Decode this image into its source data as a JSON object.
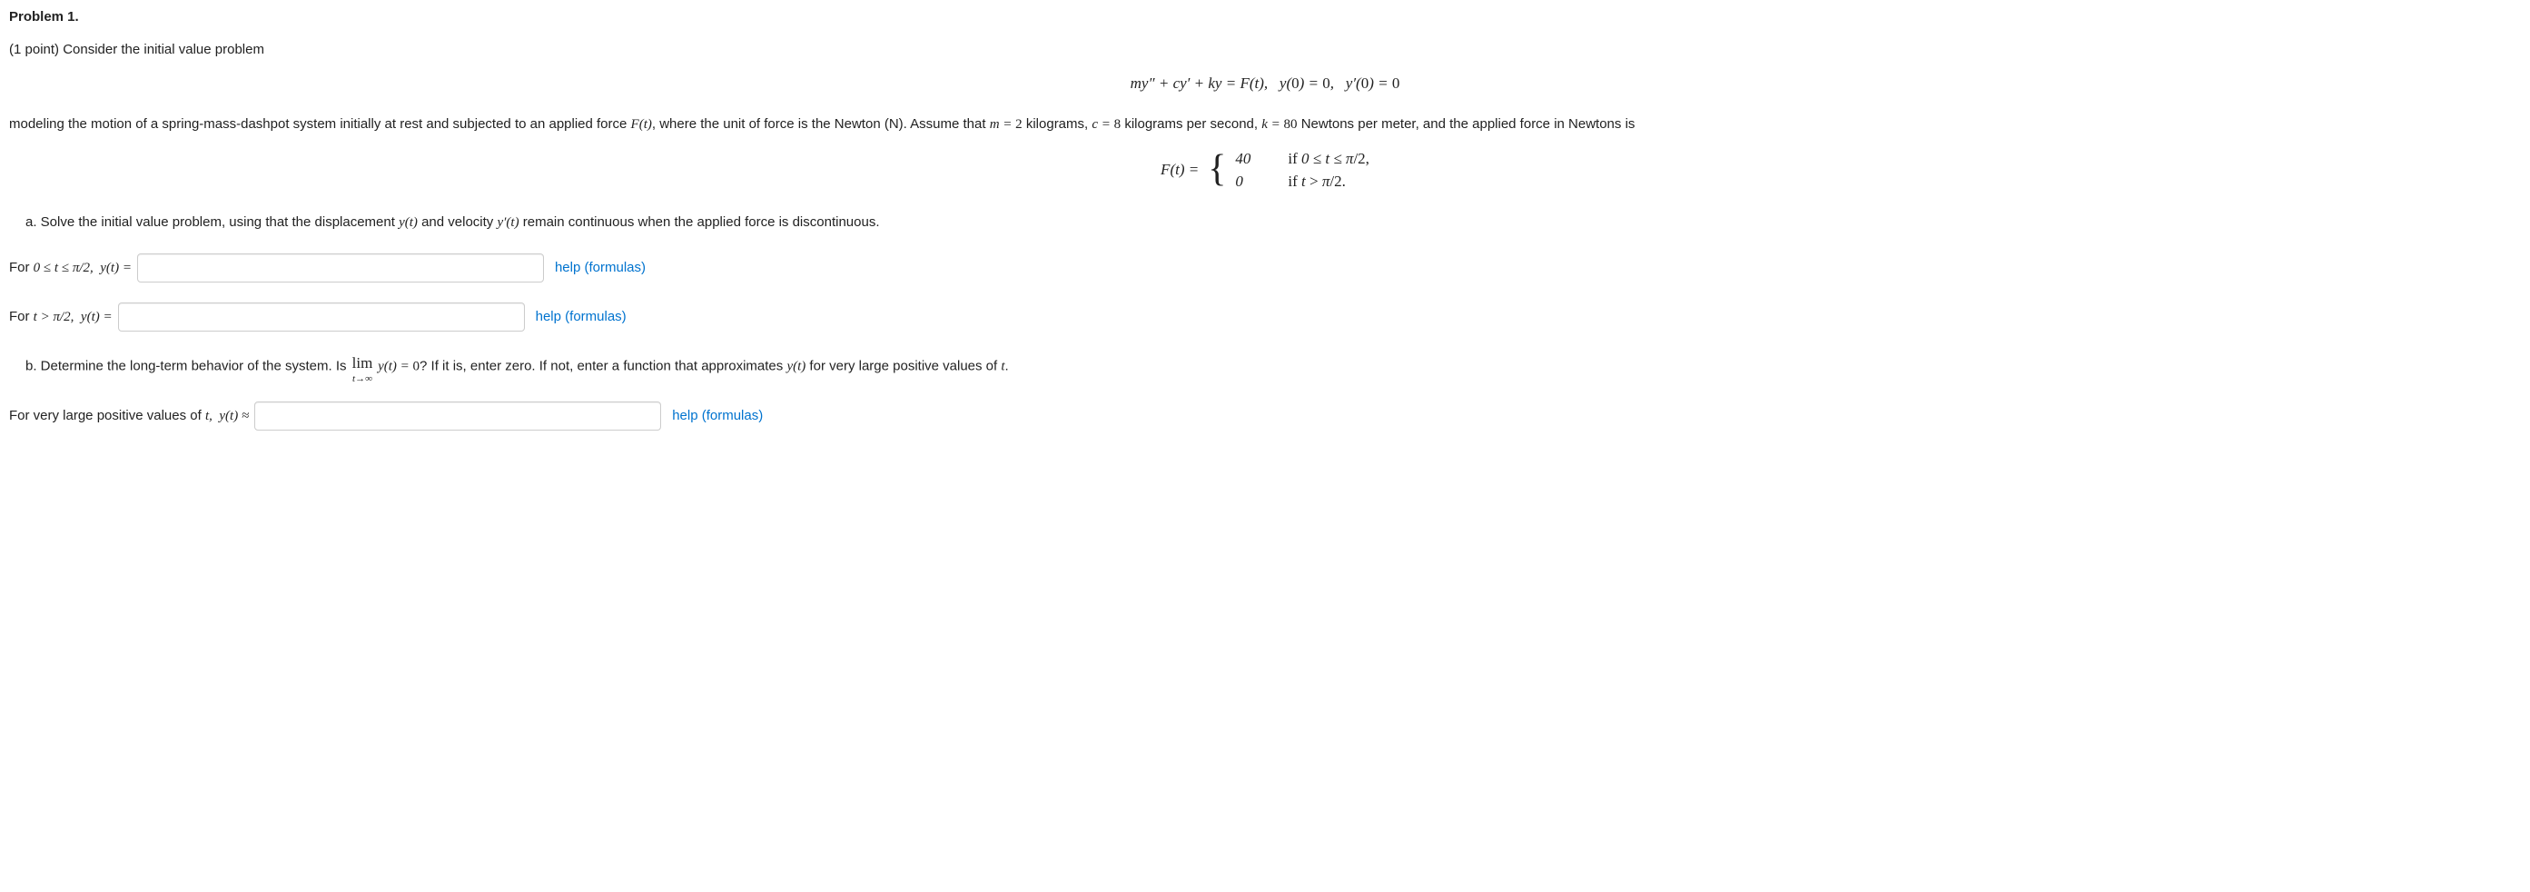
{
  "header": {
    "title": "Problem 1."
  },
  "intro": {
    "points": "(1 point) Consider the initial value problem",
    "ode": "my″ + cy′ + ky = F(t),   y(0) = 0,   y′(0) = 0"
  },
  "setup": {
    "text_a": "modeling the motion of a spring-mass-dashpot system initially at rest and subjected to an applied force ",
    "Ft": "F(t)",
    "text_b": ", where the unit of force is the Newton (N). Assume that ",
    "m_eq": "m = 2",
    "text_c": " kilograms, ",
    "c_eq": "c = 8",
    "text_d": " kilograms per second, ",
    "k_eq": "k = 80",
    "text_e": " Newtons per meter, and the applied force in Newtons is"
  },
  "piecewise": {
    "lhs": "F(t) =",
    "row1": {
      "val": "40",
      "cond_pre": "if ",
      "cond_math": "0 ≤ t ≤ π/2,",
      "cond_post": ""
    },
    "row2": {
      "val": "0",
      "cond_pre": "if ",
      "cond_math": "t > π/2.",
      "cond_post": ""
    }
  },
  "part_a": {
    "text": "a. Solve the initial value problem, using that the displacement ",
    "yt": "y(t)",
    "mid": " and velocity ",
    "ypt": "y′(t)",
    "tail": " remain continuous when the applied force is discontinuous."
  },
  "answers": {
    "line1_pre": "For ",
    "line1_rng": "0 ≤ t ≤ π/2,   y(t) =",
    "line2_pre": "For ",
    "line2_rng": "t > π/2,   y(t) =",
    "help": "help (formulas)"
  },
  "part_b": {
    "lead": "b. Determine the long-term behavior of the system. Is ",
    "lim_top": "lim",
    "lim_sub": "t→∞",
    "lim_arg": " y(t) = 0",
    "tail": "? If it is, enter zero. If not, enter a function that approximates ",
    "yt": "y(t)",
    "tail2": " for very large positive values of ",
    "tvar": "t",
    "tail3": "."
  },
  "answer_b": {
    "label_pre": "For very large positive values of ",
    "label_mid": "t,  y(t) ≈"
  }
}
